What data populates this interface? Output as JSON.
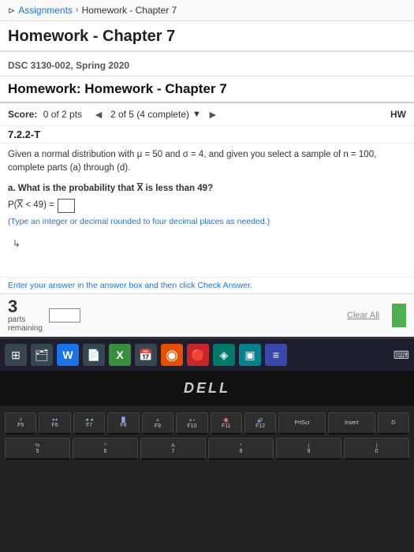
{
  "breadcrumb": {
    "home_symbol": "⊳",
    "assignments_label": "Assignments",
    "separator1": "›",
    "homework_label": "Homework - Chapter 7"
  },
  "page_title": "Homework - Chapter 7",
  "course": {
    "label": "DSC 3130-002, Spring 2020"
  },
  "assignment": {
    "title": "Homework: Homework - Chapter 7",
    "score_label": "Score:",
    "score_value": "0 of 2 pts",
    "page_info": "2 of 5 (4 complete)",
    "hw_abbr": "HW",
    "question_number": "7.2.2-T",
    "given_text": "Given a normal distribution with μ = 50 and σ = 4, and given you select a sample of n = 100, complete parts (a) through (d).",
    "part_a_label": "a. What is the probability that X̄ is less than 49?",
    "prob_line": "P(X̄ < 49) =",
    "note_text": "(Type an integer or decimal rounded to four decimal places as needed.)",
    "answer_instruction": "Enter your answer in the answer box and then click Check Answer.",
    "parts_number": "3",
    "parts_label": "parts",
    "remaining_label": "remaining",
    "clear_all_label": "Clear All"
  },
  "taskbar": {
    "icons": [
      {
        "name": "search-icon",
        "symbol": "⊞",
        "bg": "dark-bg"
      },
      {
        "name": "file-explorer-icon",
        "symbol": "📁",
        "bg": "dark-bg"
      },
      {
        "name": "word-icon",
        "symbol": "W",
        "bg": "blue-bg"
      },
      {
        "name": "file-icon",
        "symbol": "📄",
        "bg": "dark-bg"
      },
      {
        "name": "excel-icon",
        "symbol": "X",
        "bg": "green-bg"
      },
      {
        "name": "calendar-icon",
        "symbol": "📅",
        "bg": "dark-bg"
      },
      {
        "name": "chrome-icon",
        "symbol": "●",
        "bg": "orange-bg"
      },
      {
        "name": "firefox-icon",
        "symbol": "◉",
        "bg": "red-bg"
      },
      {
        "name": "app1-icon",
        "symbol": "◈",
        "bg": "teal-bg"
      },
      {
        "name": "app2-icon",
        "symbol": "▣",
        "bg": "cyan-bg"
      },
      {
        "name": "network-icon",
        "symbol": "≡",
        "bg": "indigo-bg"
      }
    ],
    "right_icon": "⌨"
  },
  "dell": {
    "logo": "DELL"
  },
  "keyboard": {
    "row1": [
      "F5",
      "F6",
      "F7",
      "F8",
      "F9",
      "F10",
      "F11",
      "F12",
      "PrtScr",
      "Insert",
      "D"
    ],
    "row2": [
      "%\n5",
      "^\n6",
      "&\n7",
      "*\n8",
      "(\n9",
      ")\n0"
    ]
  }
}
